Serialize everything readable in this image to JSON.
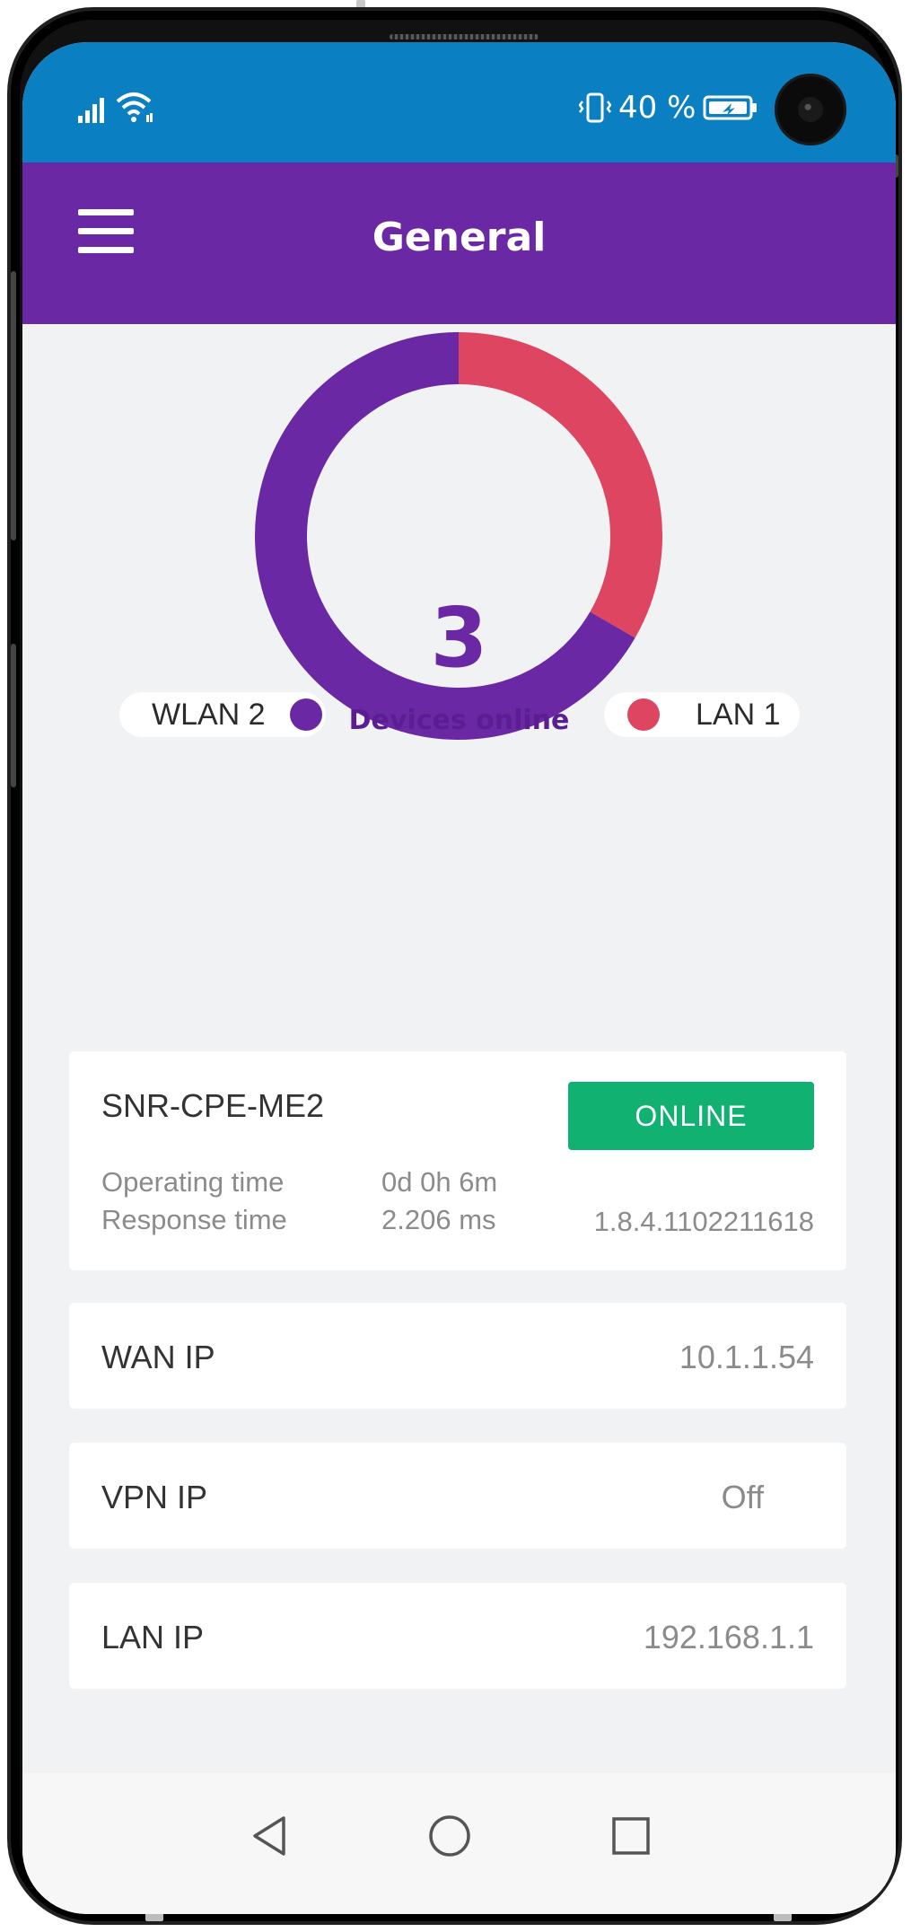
{
  "status_bar": {
    "battery_text": "40 %"
  },
  "app_bar": {
    "title": "General"
  },
  "donut": {
    "count": "3",
    "label": "Devices online",
    "segments": [
      {
        "name": "WLAN 2",
        "value": 2,
        "color": "#6a28a4"
      },
      {
        "name": "LAN 1",
        "value": 1,
        "color": "#dd4560"
      }
    ]
  },
  "device": {
    "name": "SNR-CPE-ME2",
    "status": "ONLINE",
    "operating_time_label": "Operating time",
    "operating_time_value": "0d 0h 6m",
    "response_time_label": "Response time",
    "response_time_value": "2.206 ms",
    "firmware": "1.8.4.1102211618"
  },
  "info": {
    "wan_label": "WAN IP",
    "wan_value": "10.1.1.54",
    "vpn_label": "VPN IP",
    "vpn_value": "Off",
    "lan_label": "LAN IP",
    "lan_value": "192.168.1.1"
  },
  "icons": {
    "menu": "hamburger-menu-icon",
    "signal": "cell-signal-icon",
    "wifi": "wifi-icon",
    "vibrate": "vibrate-icon",
    "battery": "battery-icon",
    "back": "back-triangle-icon",
    "home": "home-circle-icon",
    "recent": "recent-apps-square-icon"
  },
  "colors": {
    "status_bar": "#0a7fc2",
    "app_bar": "#6a28a4",
    "online": "#10b171",
    "lan_segment": "#dd4560"
  }
}
